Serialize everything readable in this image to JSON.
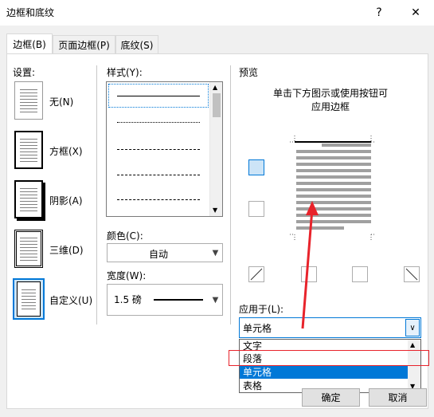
{
  "window": {
    "title": "边框和底纹",
    "help": "?",
    "close": "✕"
  },
  "tabs": [
    {
      "label": "边框(B)"
    },
    {
      "label": "页面边框(P)"
    },
    {
      "label": "底纹(S)"
    }
  ],
  "settings": {
    "heading": "设置:",
    "items": [
      {
        "label": "无(N)"
      },
      {
        "label": "方框(X)"
      },
      {
        "label": "阴影(A)"
      },
      {
        "label": "三维(D)"
      },
      {
        "label": "自定义(U)"
      }
    ]
  },
  "style": {
    "heading": "样式(Y):"
  },
  "color": {
    "heading": "颜色(C):",
    "value": "自动"
  },
  "width": {
    "heading": "宽度(W):",
    "value": "1.5 磅"
  },
  "preview": {
    "heading": "预览",
    "instruction_line1": "单击下方图示或使用按钮可",
    "instruction_line2": "应用边框"
  },
  "apply_to": {
    "heading": "应用于(L):",
    "value": "单元格",
    "options": [
      "文字",
      "段落",
      "单元格",
      "表格"
    ],
    "selected": "单元格",
    "highlighted": "段落"
  },
  "buttons": {
    "ok": "确定",
    "cancel": "取消"
  },
  "colors": {
    "selection": "#0078d7",
    "annotation": "#e8232b"
  }
}
